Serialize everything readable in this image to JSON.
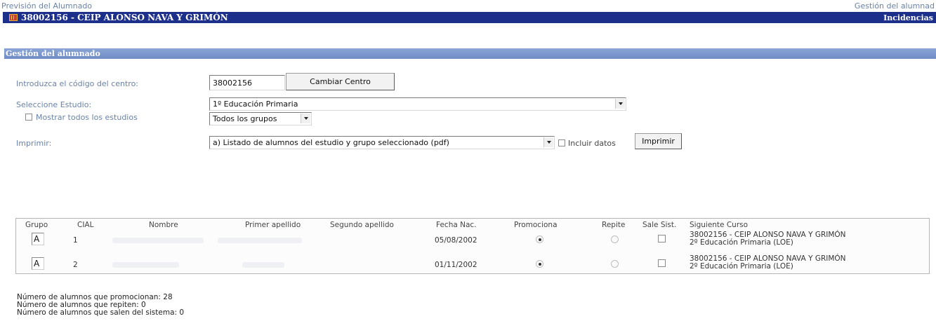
{
  "topbar": {
    "left_link": "Previsión del Alumnado",
    "right_link": "Gestión del alumnad"
  },
  "titlebar": {
    "center_title": "38002156 - CEIP ALONSO NAVA Y GRIMÓN",
    "right_link": "Incidencias"
  },
  "section": {
    "title": "Gestión del alumnado"
  },
  "form": {
    "center_code_label": "Introduzca el código del centro:",
    "center_code_value": "38002156",
    "change_center_button": "Cambiar Centro",
    "study_label": "Seleccione Estudio:",
    "study_value": "1º Educación Primaria",
    "show_all_label": "Mostrar todos los estudios",
    "group_value": "Todos los grupos",
    "print_label": "Imprimir:",
    "print_value": "a) Listado de alumnos del estudio y grupo seleccionado (pdf)",
    "include_data_label": "Incluir datos",
    "print_button": "Imprimir"
  },
  "table": {
    "headers": [
      "Grupo",
      "CIAL",
      "Nombre",
      "Primer apellido",
      "Segundo apellido",
      "Fecha Nac.",
      "Promociona",
      "Repite",
      "Sale Sist.",
      "Siguiente Curso"
    ],
    "rows": [
      {
        "grupo": "A",
        "cial": "1",
        "fecha": "05/08/2002",
        "promociona": true,
        "repite": false,
        "sale": false,
        "siguiente_line1": "38002156 - CEIP ALONSO NAVA Y GRIMÓN",
        "siguiente_line2": "2º Educación Primaria (LOE)"
      },
      {
        "grupo": "A",
        "cial": "2",
        "fecha": "01/11/2002",
        "promociona": true,
        "repite": false,
        "sale": false,
        "siguiente_line1": "38002156 - CEIP ALONSO NAVA Y GRIMÓN",
        "siguiente_line2": "2º Educación Primaria (LOE)"
      }
    ]
  },
  "summary": {
    "promocionan": "Número de alumnos que promocionan: 28",
    "repiten": "Número de alumnos que repiten: 0",
    "salen": "Número de alumnos que salen del sistema: 0"
  }
}
